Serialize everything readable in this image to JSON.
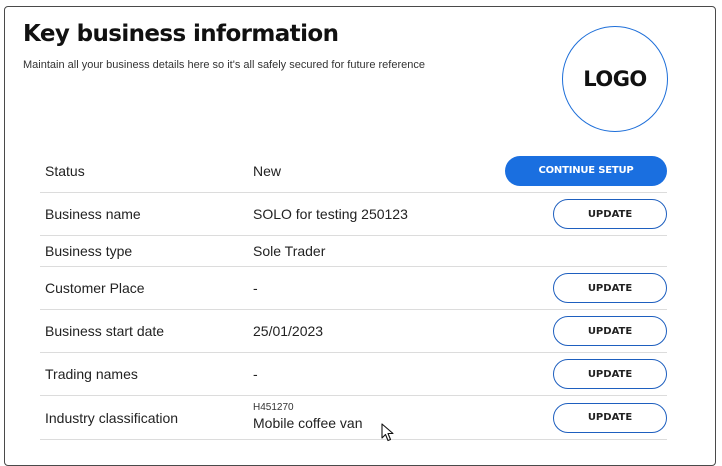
{
  "header": {
    "title": "Key business information",
    "subtitle": "Maintain all your business details here so it's all safely secured for future reference",
    "logo_text": "LOGO"
  },
  "rows": [
    {
      "label": "Status",
      "value": "New",
      "action": "CONTINUE SETUP"
    },
    {
      "label": "Business name",
      "value": "SOLO for testing 250123",
      "action": "UPDATE"
    },
    {
      "label": "Business type",
      "value": "Sole Trader"
    },
    {
      "label": "Customer Place",
      "value": "-",
      "action": "UPDATE"
    },
    {
      "label": "Business start date",
      "value": "25/01/2023",
      "action": "UPDATE"
    },
    {
      "label": "Trading names",
      "value": "-",
      "action": "UPDATE"
    },
    {
      "label": "Industry classification",
      "code": "H451270",
      "value": "Mobile coffee van",
      "action": "UPDATE"
    }
  ],
  "colors": {
    "primary": "#1a6fe0",
    "outline": "#1e5fbf",
    "logo_border": "#1e6fd9"
  }
}
